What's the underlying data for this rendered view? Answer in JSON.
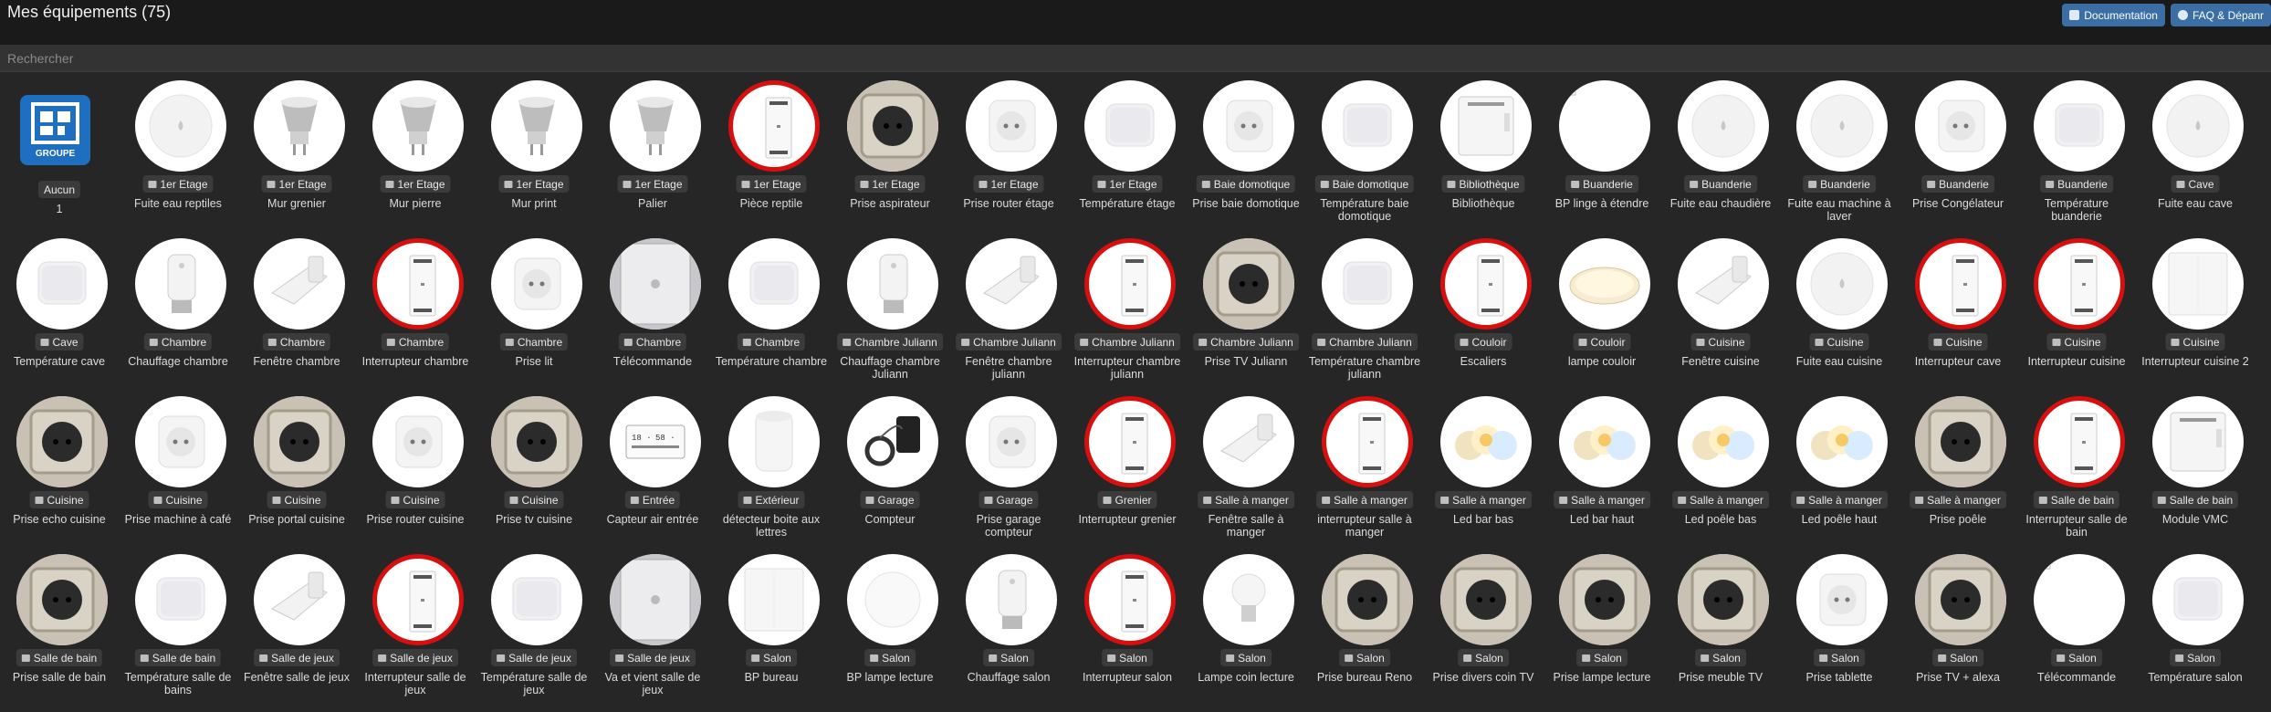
{
  "header": {
    "title": "Mes équipements (75)",
    "documentation_label": "Documentation",
    "faq_label": "FAQ & Dépanr"
  },
  "search": {
    "placeholder": "Rechercher"
  },
  "group_card": {
    "logo_label": "GROUPE",
    "room": "Aucun",
    "name": "1"
  },
  "devices": [
    {
      "room": "1er Etage",
      "name": "Fuite eau reptiles",
      "img": "leak"
    },
    {
      "room": "1er Etage",
      "name": "Mur grenier",
      "img": "bulb"
    },
    {
      "room": "1er Etage",
      "name": "Mur pierre",
      "img": "bulb"
    },
    {
      "room": "1er Etage",
      "name": "Mur print",
      "img": "bulb"
    },
    {
      "room": "1er Etage",
      "name": "Palier",
      "img": "bulb"
    },
    {
      "room": "1er Etage",
      "name": "Pièce reptile",
      "img": "module"
    },
    {
      "room": "1er Etage",
      "name": "Prise aspirateur",
      "img": "socket"
    },
    {
      "room": "1er Etage",
      "name": "Prise router étage",
      "img": "plug"
    },
    {
      "room": "1er Etage",
      "name": "Température étage",
      "img": "sensor"
    },
    {
      "room": "Baie domotique",
      "name": "Prise baie domotique",
      "img": "plug"
    },
    {
      "room": "Baie domotique",
      "name": "Température baie domotique",
      "img": "sensor"
    },
    {
      "room": "Bibliothèque",
      "name": "Bibliothèque",
      "img": "box"
    },
    {
      "room": "Buanderie",
      "name": "BP linge à étendre",
      "img": "blank"
    },
    {
      "room": "Buanderie",
      "name": "Fuite eau chaudière",
      "img": "leak"
    },
    {
      "room": "Buanderie",
      "name": "Fuite eau machine à laver",
      "img": "leak"
    },
    {
      "room": "Buanderie",
      "name": "Prise Congélateur",
      "img": "plug"
    },
    {
      "room": "Buanderie",
      "name": "Température buanderie",
      "img": "sensor"
    },
    {
      "room": "Cave",
      "name": "Fuite eau cave",
      "img": "leak"
    },
    {
      "room": "Cave",
      "name": "Température cave",
      "img": "sensor"
    },
    {
      "room": "Chambre",
      "name": "Chauffage chambre",
      "img": "valve"
    },
    {
      "room": "Chambre",
      "name": "Fenêtre chambre",
      "img": "window"
    },
    {
      "room": "Chambre",
      "name": "Interrupteur chambre",
      "img": "module"
    },
    {
      "room": "Chambre",
      "name": "Prise lit",
      "img": "plug"
    },
    {
      "room": "Chambre",
      "name": "Télécommande",
      "img": "remote"
    },
    {
      "room": "Chambre",
      "name": "Température chambre",
      "img": "sensor"
    },
    {
      "room": "Chambre Juliann",
      "name": "Chauffage chambre Juliann",
      "img": "valve"
    },
    {
      "room": "Chambre Juliann",
      "name": "Fenêtre chambre juliann",
      "img": "window"
    },
    {
      "room": "Chambre Juliann",
      "name": "Interrupteur chambre juliann",
      "img": "module"
    },
    {
      "room": "Chambre Juliann",
      "name": "Prise TV Juliann",
      "img": "socket"
    },
    {
      "room": "Chambre Juliann",
      "name": "Température chambre juliann",
      "img": "sensor"
    },
    {
      "room": "Couloir",
      "name": "Escaliers",
      "img": "module"
    },
    {
      "room": "Couloir",
      "name": "lampe couloir",
      "img": "ceiling"
    },
    {
      "room": "Cuisine",
      "name": "Fenêtre cuisine",
      "img": "window"
    },
    {
      "room": "Cuisine",
      "name": "Fuite eau cuisine",
      "img": "leak"
    },
    {
      "room": "Cuisine",
      "name": "Interrupteur cave",
      "img": "module"
    },
    {
      "room": "Cuisine",
      "name": "Interrupteur cuisine",
      "img": "module"
    },
    {
      "room": "Cuisine",
      "name": "Interrupteur cuisine 2",
      "img": "switch"
    },
    {
      "room": "Cuisine",
      "name": "Prise echo cuisine",
      "img": "socket"
    },
    {
      "room": "Cuisine",
      "name": "Prise machine à café",
      "img": "plug"
    },
    {
      "room": "Cuisine",
      "name": "Prise portal cuisine",
      "img": "socket"
    },
    {
      "room": "Cuisine",
      "name": "Prise router cuisine",
      "img": "plug"
    },
    {
      "room": "Cuisine",
      "name": "Prise tv cuisine",
      "img": "socket"
    },
    {
      "room": "Entrée",
      "name": "Capteur air entrée",
      "img": "display"
    },
    {
      "room": "Extérieur",
      "name": "détecteur boite aux lettres",
      "img": "motion"
    },
    {
      "room": "Garage",
      "name": "Compteur",
      "img": "clamp"
    },
    {
      "room": "Garage",
      "name": "Prise garage compteur",
      "img": "plug"
    },
    {
      "room": "Grenier",
      "name": "Interrupteur grenier",
      "img": "module"
    },
    {
      "room": "Salle à manger",
      "name": "Fenêtre salle à manger",
      "img": "window"
    },
    {
      "room": "Salle à manger",
      "name": "interrupteur salle à manger",
      "img": "module"
    },
    {
      "room": "Salle à manger",
      "name": "Led bar bas",
      "img": "spots"
    },
    {
      "room": "Salle à manger",
      "name": "Led bar haut",
      "img": "spots"
    },
    {
      "room": "Salle à manger",
      "name": "Led poêle bas",
      "img": "spots"
    },
    {
      "room": "Salle à manger",
      "name": "Led poêle haut",
      "img": "spots"
    },
    {
      "room": "Salle à manger",
      "name": "Prise poêle",
      "img": "socket"
    },
    {
      "room": "Salle de bain",
      "name": "Interrupteur salle de bain",
      "img": "module"
    },
    {
      "room": "Salle de bain",
      "name": "Module VMC",
      "img": "box"
    },
    {
      "room": "Salle de bain",
      "name": "Prise salle de bain",
      "img": "socket"
    },
    {
      "room": "Salle de bain",
      "name": "Température salle de bains",
      "img": "sensor"
    },
    {
      "room": "Salle de jeux",
      "name": "Fenêtre salle de jeux",
      "img": "window"
    },
    {
      "room": "Salle de jeux",
      "name": "Interrupteur salle de jeux",
      "img": "module"
    },
    {
      "room": "Salle de jeux",
      "name": "Température salle de jeux",
      "img": "sensor"
    },
    {
      "room": "Salle de jeux",
      "name": "Va et vient salle de jeux",
      "img": "remote"
    },
    {
      "room": "Salon",
      "name": "BP bureau",
      "img": "switch"
    },
    {
      "room": "Salon",
      "name": "BP lampe lecture",
      "img": "round"
    },
    {
      "room": "Salon",
      "name": "Chauffage salon",
      "img": "valve"
    },
    {
      "room": "Salon",
      "name": "Interrupteur salon",
      "img": "module"
    },
    {
      "room": "Salon",
      "name": "Lampe coin lecture",
      "img": "ebulb"
    },
    {
      "room": "Salon",
      "name": "Prise bureau Reno",
      "img": "socket"
    },
    {
      "room": "Salon",
      "name": "Prise divers coin TV",
      "img": "socket"
    },
    {
      "room": "Salon",
      "name": "Prise lampe lecture",
      "img": "socket"
    },
    {
      "room": "Salon",
      "name": "Prise meuble TV",
      "img": "socket"
    },
    {
      "room": "Salon",
      "name": "Prise tablette",
      "img": "plug"
    },
    {
      "room": "Salon",
      "name": "Prise TV + alexa",
      "img": "socket"
    },
    {
      "room": "Salon",
      "name": "Télécommande",
      "img": "blank"
    },
    {
      "room": "Salon",
      "name": "Température salon",
      "img": "sensor"
    }
  ]
}
